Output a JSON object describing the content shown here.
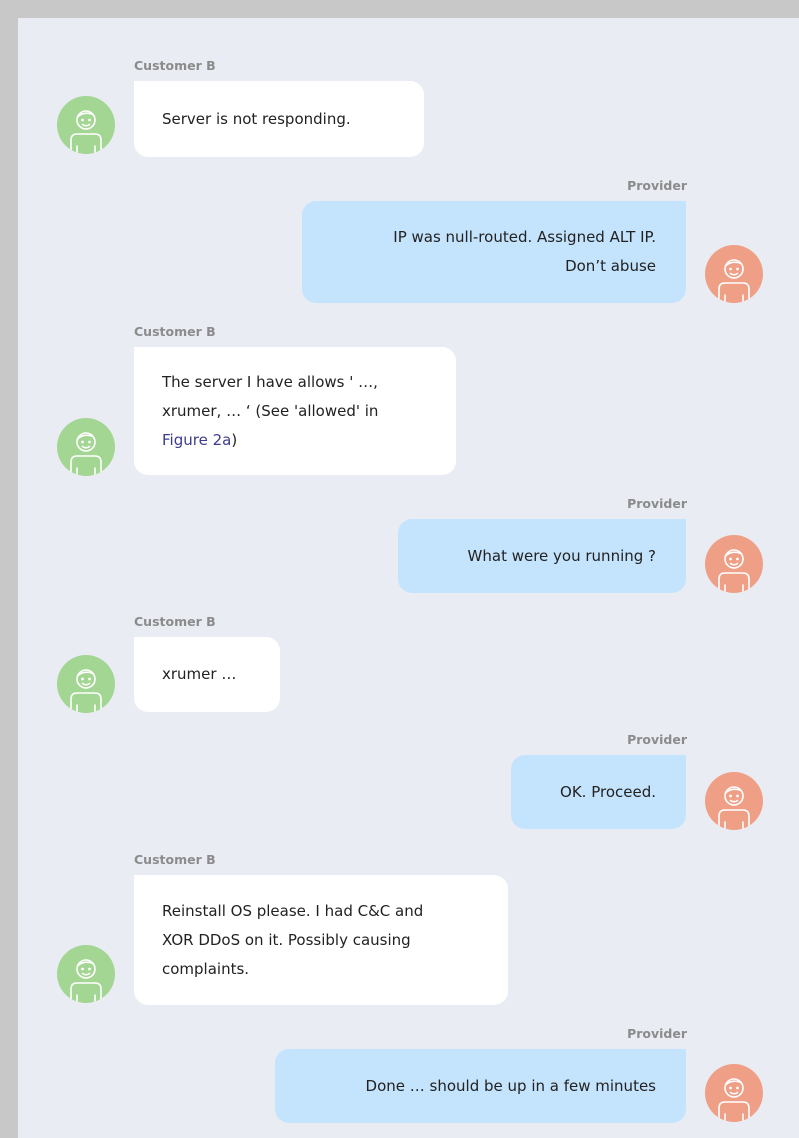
{
  "chat": {
    "colors": {
      "panel_bg": "#e9edf3",
      "customer_bubble": "#ffffff",
      "provider_bubble": "#c4e3fc",
      "customer_avatar": "#a3d593",
      "provider_avatar": "#ef9f86",
      "link": "#3d3c8c"
    },
    "messages": [
      {
        "sender": "Customer B",
        "side": "left",
        "avatar_icon": "person-icon",
        "lines": [
          "Server is not responding."
        ]
      },
      {
        "sender": "Provider",
        "side": "right",
        "avatar_icon": "person-icon",
        "lines": [
          "IP was null-routed. Assigned ALT IP.",
          "Don’t abuse"
        ]
      },
      {
        "sender": "Customer B",
        "side": "left",
        "avatar_icon": "person-icon",
        "lines": [
          "The server I have allows ' …,",
          "xrumer, … ‘ (See 'allowed' in"
        ],
        "last_line_link": "Figure 2a",
        "last_line_suffix": ")"
      },
      {
        "sender": "Provider",
        "side": "right",
        "avatar_icon": "person-icon",
        "lines": [
          "What were you running ?"
        ]
      },
      {
        "sender": "Customer B",
        "side": "left",
        "avatar_icon": "person-icon",
        "lines": [
          "xrumer …"
        ]
      },
      {
        "sender": "Provider",
        "side": "right",
        "avatar_icon": "person-icon",
        "lines": [
          "OK. Proceed."
        ]
      },
      {
        "sender": "Customer B",
        "side": "left",
        "avatar_icon": "person-icon",
        "lines": [
          "Reinstall OS please. I had C&C and",
          "XOR DDoS on it. Possibly causing",
          "complaints."
        ]
      },
      {
        "sender": "Provider",
        "side": "right",
        "avatar_icon": "person-icon",
        "lines": [
          "Done … should be up in a few minutes"
        ]
      }
    ]
  }
}
